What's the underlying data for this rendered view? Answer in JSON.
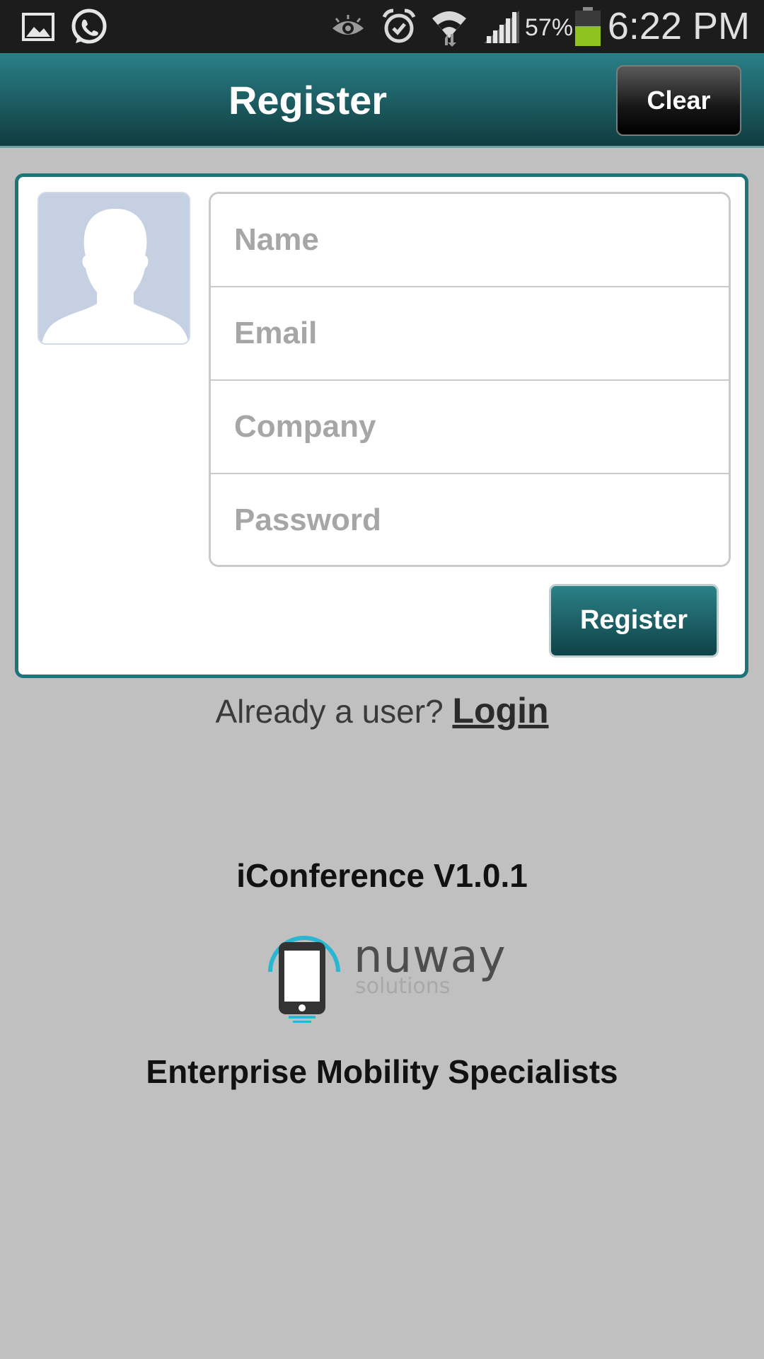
{
  "status_bar": {
    "time": "6:22 PM",
    "battery_percent": "57%",
    "battery_level": 0.57,
    "icons": [
      "gallery-icon",
      "whatsapp-icon",
      "eye-icon",
      "alarm-icon",
      "wifi-icon",
      "signal-icon",
      "battery-icon"
    ]
  },
  "action_bar": {
    "title": "Register",
    "clear_label": "Clear"
  },
  "form": {
    "name_placeholder": "Name",
    "email_placeholder": "Email",
    "company_placeholder": "Company",
    "password_placeholder": "Password",
    "name_value": "",
    "email_value": "",
    "company_value": "",
    "password_value": "",
    "register_label": "Register"
  },
  "login_prompt": {
    "text": "Already a user?",
    "link": "Login"
  },
  "footer": {
    "version": "iConference V1.0.1",
    "logo_word": "nuway",
    "logo_sub": "solutions",
    "tagline": "Enterprise Mobility Specialists"
  },
  "colors": {
    "accent": "#1f7479",
    "background": "#c0c0c0",
    "logo_accent": "#29b6d0",
    "battery": "#8fc31f"
  }
}
